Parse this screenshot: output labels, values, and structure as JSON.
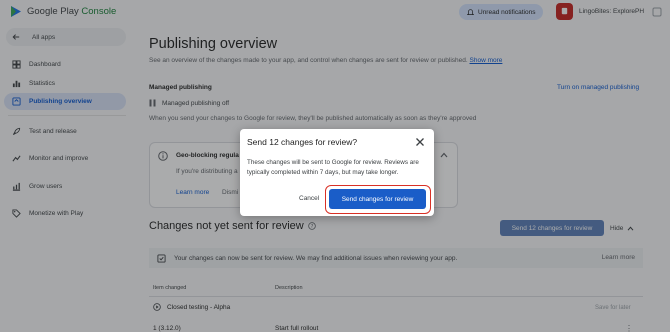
{
  "header": {
    "brand": "Google Play",
    "product": "Console",
    "notifications_label": "Unread notifications",
    "app_name": "LingoBites: ExplorePH"
  },
  "sidebar": {
    "all_apps": "All apps",
    "items": [
      {
        "label": "Dashboard",
        "icon": "dashboard-icon"
      },
      {
        "label": "Statistics",
        "icon": "bar-chart-icon"
      },
      {
        "label": "Publishing overview",
        "icon": "publishing-icon",
        "active": true
      },
      {
        "label": "Test and release",
        "icon": "rocket-icon"
      },
      {
        "label": "Monitor and improve",
        "icon": "trend-icon"
      },
      {
        "label": "Grow users",
        "icon": "grow-icon"
      },
      {
        "label": "Monetize with Play",
        "icon": "tag-icon"
      }
    ]
  },
  "main": {
    "title": "Publishing overview",
    "description": "See an overview of the changes made to your app, and control when changes are sent for review or published.",
    "show_more": "Show more",
    "managed": {
      "title": "Managed publishing",
      "link": "Turn on managed publishing",
      "status": "Managed publishing off",
      "description": "When you send your changes to Google for review, they'll be published automatically as soon as they're approved"
    },
    "geo_card": {
      "title": "Geo-blocking regula",
      "text": "If you're distributing a",
      "learn_more": "Learn more",
      "dismiss": "Dismi"
    },
    "changes": {
      "title": "Changes not yet sent for review",
      "send_button": "Send 12 changes for review",
      "hide": "Hide",
      "notice": "Your changes can now be sent for review. We may find additional issues when reviewing your app.",
      "notice_learn_more": "Learn more",
      "col_item": "Item changed",
      "col_desc": "Description",
      "row1_label": "Closed testing - Alpha",
      "row1_action": "Save for later",
      "row2_item": "1 (3.12.0)",
      "row2_desc": "Start full rollout"
    }
  },
  "dialog": {
    "title": "Send 12 changes for review?",
    "body": "These changes will be sent to Google for review. Reviews are typically completed within 7 days, but may take longer.",
    "cancel": "Cancel",
    "confirm": "Send changes for review"
  },
  "colors": {
    "primary": "#0b57d0",
    "highlight": "#d93025",
    "sidebar_active": "#d8e2f7"
  }
}
